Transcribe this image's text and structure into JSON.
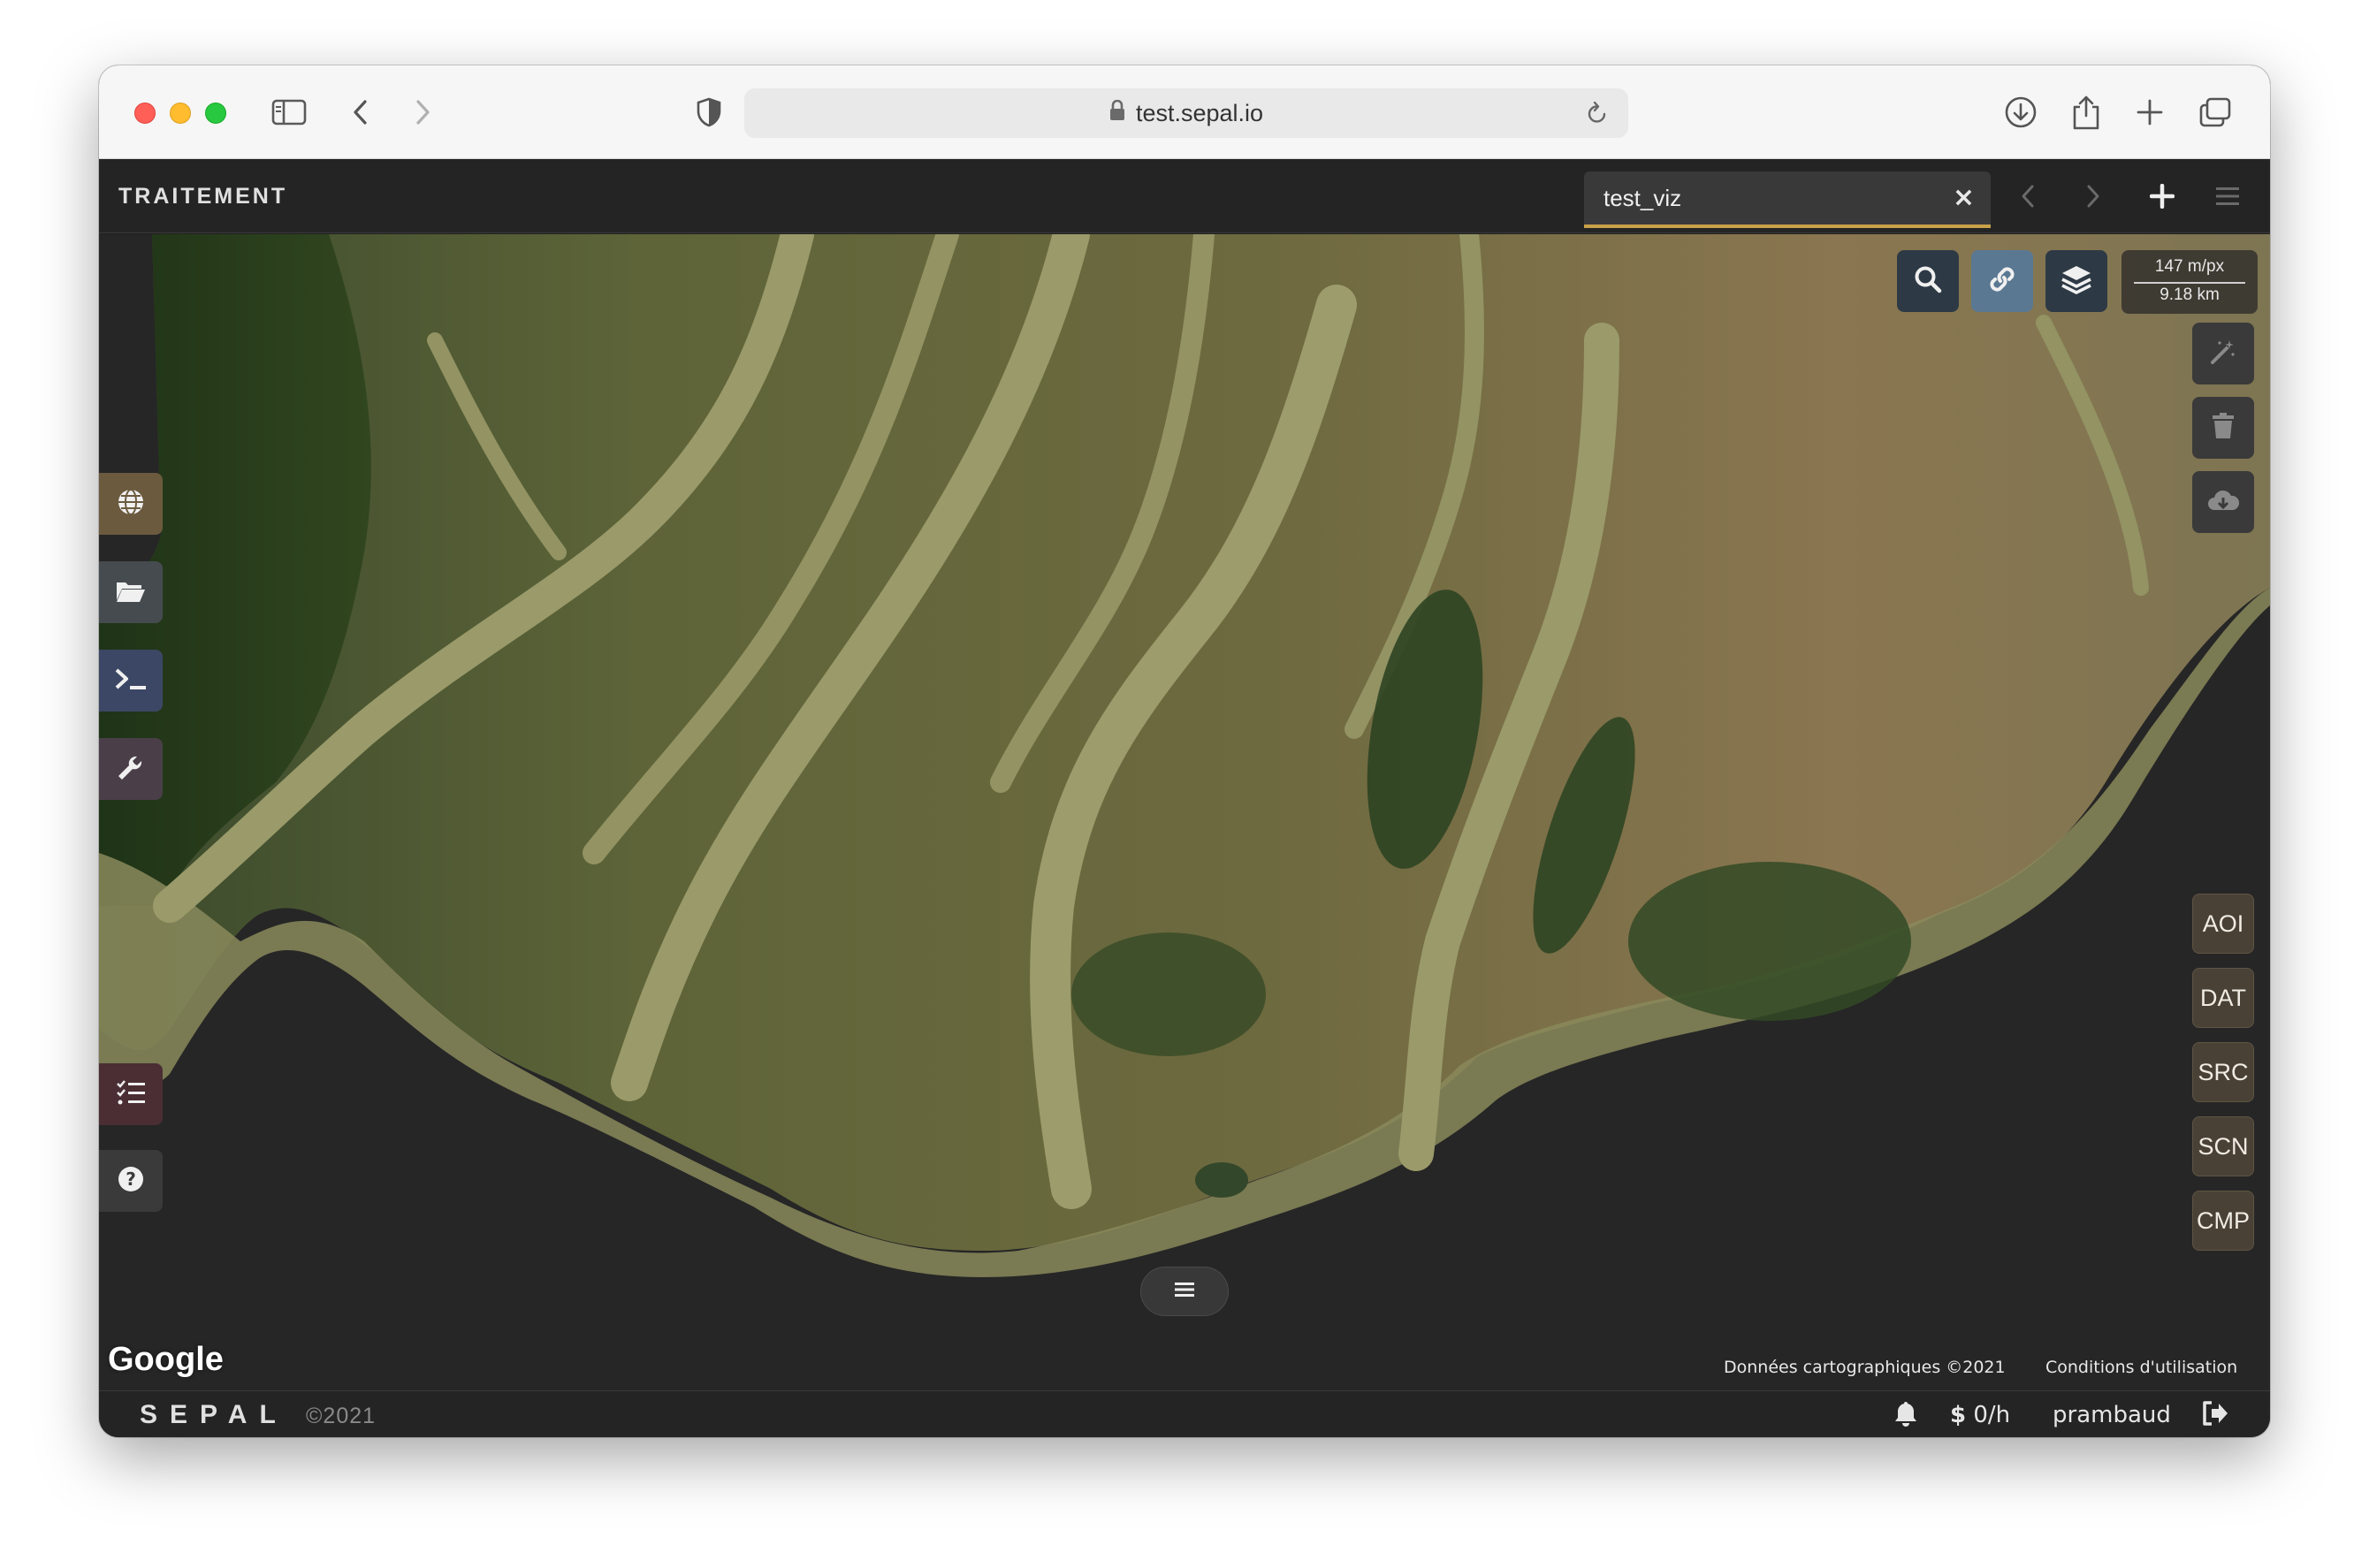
{
  "browser": {
    "url": "test.sepal.io"
  },
  "app": {
    "section_title": "TRAITEMENT",
    "tab_label": "test_viz",
    "tab_close": "×"
  },
  "map": {
    "scale_resolution": "147 m/px",
    "scale_distance": "9.18 km",
    "section_buttons": [
      "AOI",
      "DAT",
      "SRC",
      "SCN",
      "CMP"
    ],
    "attribution_data": "Données cartographiques ©2021",
    "attribution_terms": "Conditions d'utilisation",
    "google_logo": "Google"
  },
  "footer": {
    "brand": "SEPAL",
    "copyright": "©2021",
    "cost": "0/h",
    "username": "prambaud"
  },
  "colors": {
    "accent": "#c9a14a",
    "section_button_bg": "#4a4136",
    "background": "#262626"
  }
}
